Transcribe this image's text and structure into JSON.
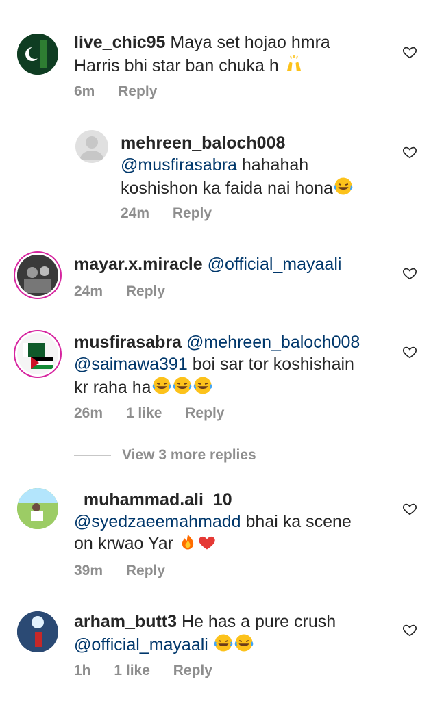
{
  "comments": [
    {
      "username": "live_chic95",
      "mention": "",
      "text_line1": "Maya set hojao hmra",
      "text_line2": "Harris bhi star ban chuka h",
      "time": "6m",
      "likes": "",
      "reply": "Reply"
    },
    {
      "username": "mehreen_baloch008",
      "mention": "@musfirasabra",
      "text_line1": "hahahah",
      "text_line2": "koshishon ka faida nai hona",
      "time": "24m",
      "likes": "",
      "reply": "Reply"
    },
    {
      "username": "mayar.x.miracle",
      "mention": "@official_mayaali",
      "time": "24m",
      "likes": "",
      "reply": "Reply"
    },
    {
      "username": "musfirasabra",
      "mention": "@mehreen_baloch008",
      "mention2": "@saimawa391",
      "text_line2": "boi sar tor koshishain",
      "text_line3": "kr raha ha",
      "time": "26m",
      "likes": "1 like",
      "reply": "Reply"
    },
    {
      "username": "_muhammad.ali_10",
      "mention": "@syedzaeemahmadd",
      "text_line2": "bhai ka scene",
      "text_line3": "on krwao Yar",
      "time": "39m",
      "likes": "",
      "reply": "Reply"
    },
    {
      "username": "arham_butt3",
      "text_line1": "He has a pure crush",
      "mention": "@official_mayaali",
      "time": "1h",
      "likes": "1 like",
      "reply": "Reply"
    }
  ],
  "view_more": "View 3 more replies",
  "icons": [
    "heart-outline-icon",
    "raising-hands-emoji",
    "laughing-tears-emoji",
    "fire-emoji",
    "red-heart-emoji"
  ]
}
